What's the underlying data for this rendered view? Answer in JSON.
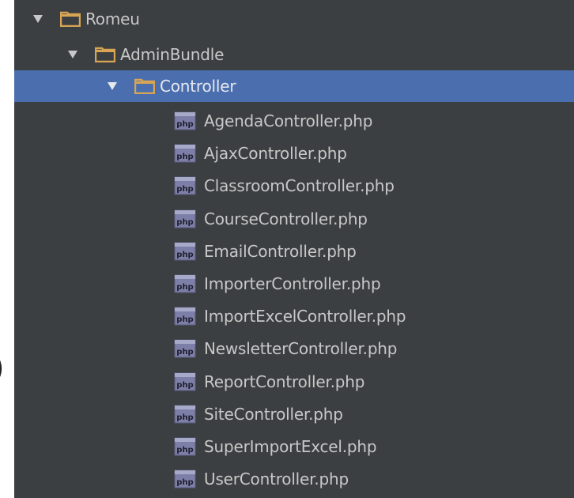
{
  "stray_text": ")",
  "colors": {
    "panel_background": "#3c3f41",
    "selection_background": "#4b6eaf",
    "label_text": "#c8c8c8",
    "folder_icon": "#d7a553"
  },
  "tree": {
    "root": {
      "label": "Romeu",
      "expanded": true,
      "icon": "folder-icon"
    },
    "bundle": {
      "label": "AdminBundle",
      "expanded": true,
      "icon": "folder-icon"
    },
    "controller_folder": {
      "label": "Controller",
      "expanded": true,
      "selected": true,
      "icon": "folder-icon"
    },
    "files": [
      {
        "label": "AgendaController.php",
        "icon": "php-file-icon"
      },
      {
        "label": "AjaxController.php",
        "icon": "php-file-icon"
      },
      {
        "label": "ClassroomController.php",
        "icon": "php-file-icon"
      },
      {
        "label": "CourseController.php",
        "icon": "php-file-icon"
      },
      {
        "label": "EmailController.php",
        "icon": "php-file-icon"
      },
      {
        "label": "ImporterController.php",
        "icon": "php-file-icon"
      },
      {
        "label": "ImportExcelController.php",
        "icon": "php-file-icon"
      },
      {
        "label": "NewsletterController.php",
        "icon": "php-file-icon"
      },
      {
        "label": "ReportController.php",
        "icon": "php-file-icon"
      },
      {
        "label": "SiteController.php",
        "icon": "php-file-icon"
      },
      {
        "label": "SuperImportExcel.php",
        "icon": "php-file-icon"
      },
      {
        "label": "UserController.php",
        "icon": "php-file-icon"
      }
    ]
  }
}
